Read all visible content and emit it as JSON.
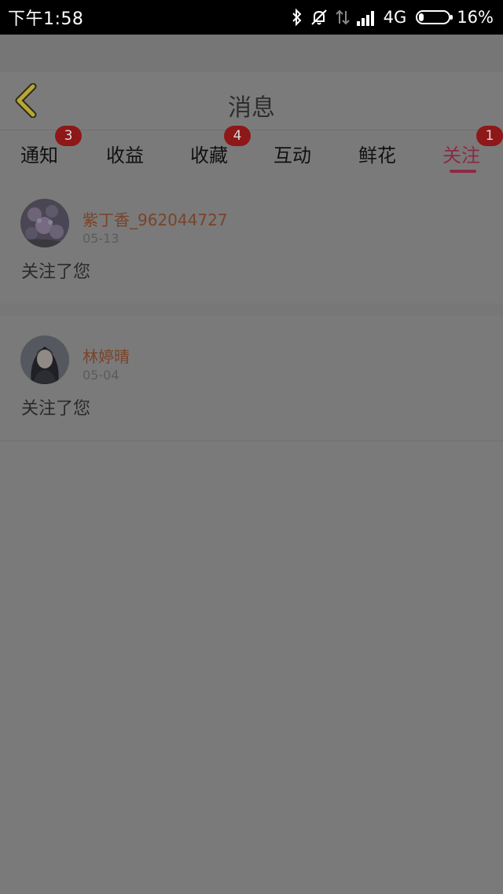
{
  "status_bar": {
    "time": "下午1:58",
    "network": "4G",
    "battery": "16%",
    "battery_level": 0.16,
    "icons": [
      "bluetooth-icon",
      "bell-off-icon",
      "data-transfer-icon",
      "signal-icon"
    ]
  },
  "header": {
    "title": "消息",
    "back_icon": "chevron-left-icon"
  },
  "tabs": [
    {
      "label": "通知",
      "badge": "3"
    },
    {
      "label": "收益",
      "badge": ""
    },
    {
      "label": "收藏",
      "badge": "4"
    },
    {
      "label": "互动",
      "badge": ""
    },
    {
      "label": "鲜花",
      "badge": ""
    },
    {
      "label": "关注",
      "badge": "1",
      "active": true
    }
  ],
  "messages": [
    {
      "name": "紫丁香_962044727",
      "date": "05-13",
      "text": "关注了您",
      "avatar": "flower-photo-avatar"
    },
    {
      "name": "林婷晴",
      "date": "05-04",
      "text": "关注了您",
      "avatar": "girl-photo-avatar"
    }
  ],
  "colors": {
    "accent": "#8b2a45",
    "badge": "#8e1717",
    "name_text": "#7a4328",
    "back_icon": "#b5a83a"
  }
}
